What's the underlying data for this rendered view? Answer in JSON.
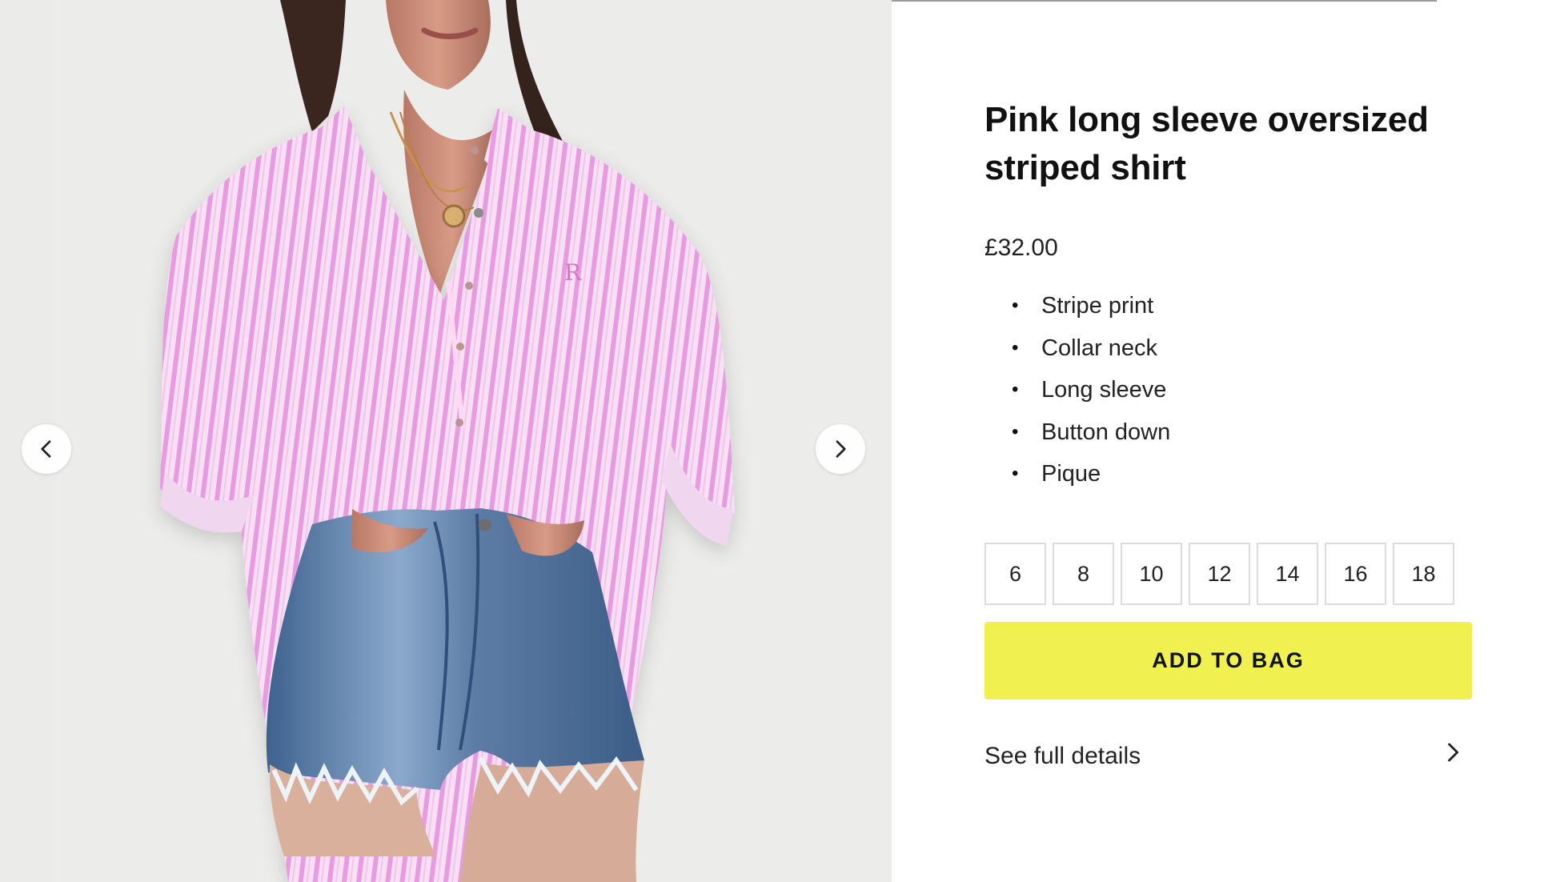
{
  "product": {
    "title": "Pink long sleeve oversized striped shirt",
    "price": "£32.00",
    "features": [
      "Stripe print",
      "Collar neck",
      "Long sleeve",
      "Button down",
      "Pique"
    ],
    "sizes": [
      "6",
      "8",
      "10",
      "12",
      "14",
      "16",
      "18"
    ]
  },
  "actions": {
    "add_to_bag": "ADD TO BAG",
    "see_full_details": "See full details"
  },
  "icons": {
    "bullet": "•",
    "previous": "chevron-left-icon",
    "next": "chevron-right-icon",
    "details": "chevron-right-icon"
  },
  "colors": {
    "add_to_bag": "#f0f051",
    "shirt_pink": "#ed9ee6",
    "denim": "#6f8fb7"
  }
}
